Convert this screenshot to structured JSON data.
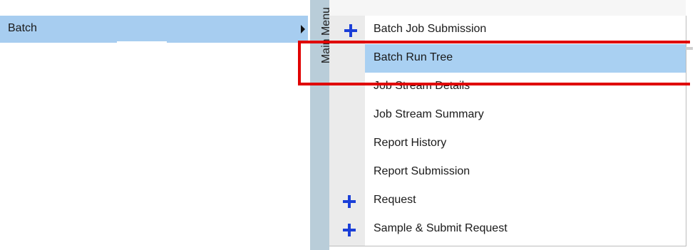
{
  "parent_menu": {
    "batch_label": "Batch"
  },
  "vertical_strip": {
    "label": "Main Menu"
  },
  "submenu": {
    "items": [
      {
        "label": "Batch Job Submission",
        "has_plus": true,
        "highlighted": false
      },
      {
        "label": "Batch Run Tree",
        "has_plus": false,
        "highlighted": true
      },
      {
        "label": "Job Stream Details",
        "has_plus": false,
        "highlighted": false
      },
      {
        "label": "Job Stream Summary",
        "has_plus": false,
        "highlighted": false
      },
      {
        "label": "Report History",
        "has_plus": false,
        "highlighted": false
      },
      {
        "label": "Report Submission",
        "has_plus": false,
        "highlighted": false
      },
      {
        "label": "Request",
        "has_plus": true,
        "highlighted": false
      },
      {
        "label": "Sample & Submit Request",
        "has_plus": true,
        "highlighted": false
      }
    ]
  },
  "colors": {
    "highlight": "#a9d0f2",
    "plus_icon": "#1b3fd8",
    "annotation_red": "#e00000"
  },
  "icons": [
    "plus-icon",
    "submenu-arrow-icon"
  ]
}
